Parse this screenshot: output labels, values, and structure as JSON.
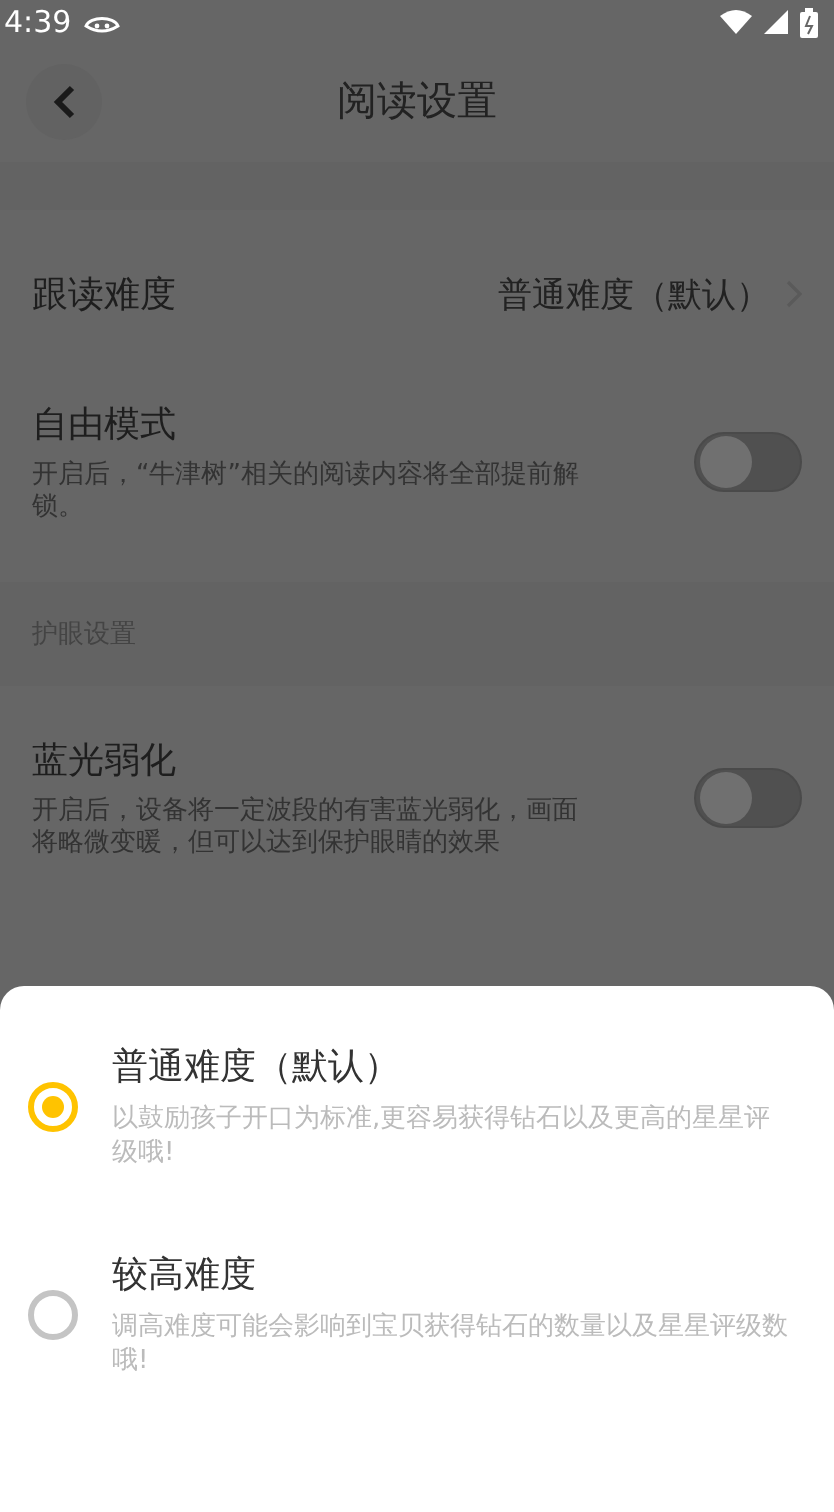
{
  "status_bar": {
    "time": "4:39"
  },
  "header": {
    "title": "阅读设置"
  },
  "settings": [
    {
      "kind": "value",
      "label": "跟读难度",
      "value": "普通难度（默认）"
    },
    {
      "kind": "toggle",
      "label": "自由模式",
      "description": "开启后，“牛津树”相关的阅读内容将全部提前解锁。",
      "on": false
    },
    {
      "kind": "section",
      "label": "护眼设置"
    },
    {
      "kind": "toggle",
      "label": "蓝光弱化",
      "description": "开启后，设备将一定波段的有害蓝光弱化，画面将略微变暖，但可以达到保护眼睛的效果",
      "on": false
    }
  ],
  "sheet": {
    "options": [
      {
        "title": "普通难度（默认）",
        "description": "以鼓励孩子开口为标准,更容易获得钻石以及更高的星星评级哦!",
        "selected": true
      },
      {
        "title": "较高难度",
        "description": "调高难度可能会影响到宝贝获得钻石的数量以及星星评级数哦!",
        "selected": false
      }
    ]
  }
}
